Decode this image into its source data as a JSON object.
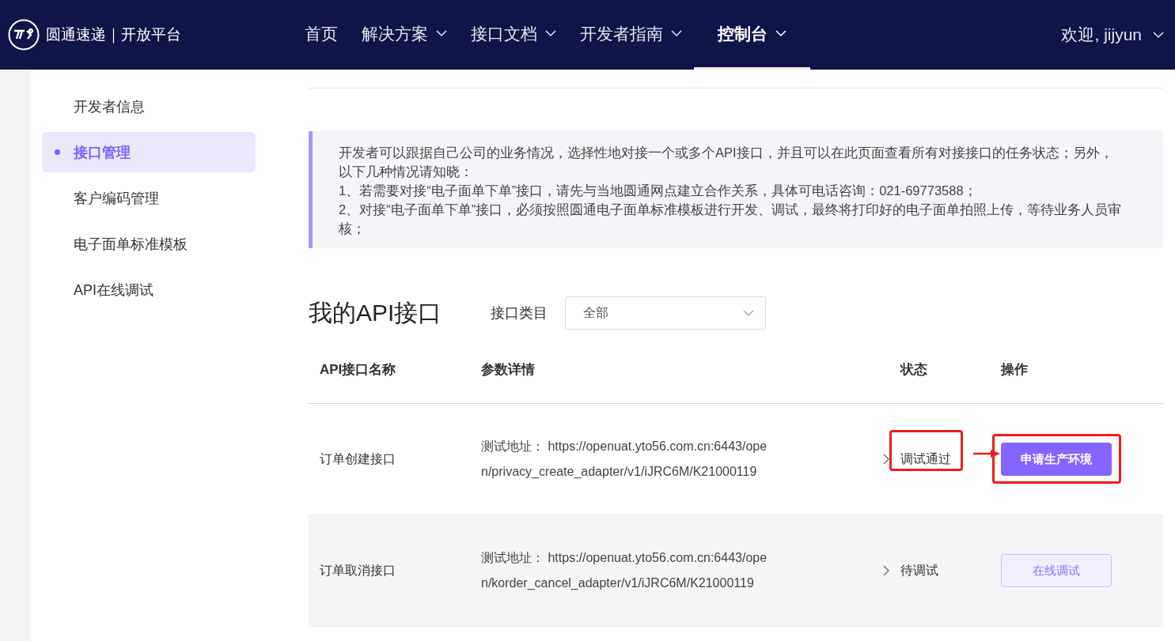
{
  "header": {
    "brand": "圆通速递｜开放平台",
    "nav": [
      {
        "label": "首页",
        "dropdown": false,
        "selected": false
      },
      {
        "label": "解决方案",
        "dropdown": true,
        "selected": false
      },
      {
        "label": "接口文档",
        "dropdown": true,
        "selected": false
      },
      {
        "label": "开发者指南",
        "dropdown": true,
        "selected": false
      },
      {
        "label": "控制台",
        "dropdown": true,
        "selected": true
      }
    ],
    "user": "欢迎, jijyun"
  },
  "sidebar": {
    "items": [
      {
        "label": "开发者信息",
        "selected": false
      },
      {
        "label": "接口管理",
        "selected": true
      },
      {
        "label": "客户编码管理",
        "selected": false
      },
      {
        "label": "电子面单标准模板",
        "selected": false
      },
      {
        "label": "API在线调试",
        "selected": false
      }
    ]
  },
  "notice": {
    "lines": [
      "开发者可以跟据自己公司的业务情况，选择性地对接一个或多个API接口，并且可以在此页面查看所有对接接口的任务状态；另外，以下几种情况请知晓：",
      "1、若需要对接“电子面单下单”接口，请先与当地圆通网点建立合作关系，具体可电话咨询：021-69773588；",
      "2、对接“电子面单下单”接口，必须按照圆通电子面单标准模板进行开发、调试，最终将打印好的电子面单拍照上传，等待业务人员审核；"
    ]
  },
  "section_title": "我的API接口",
  "filter": {
    "label": "接口类目",
    "value": "全部"
  },
  "table": {
    "columns": [
      "API接口名称",
      "参数详情",
      "状态",
      "操作"
    ],
    "rows": [
      {
        "name": "订单创建接口",
        "params": "测试地址： https://openuat.yto56.com.cn:6443/open/privacy_create_adapter/v1/iJRC6M/K21000119",
        "status": "调试通过",
        "action": {
          "kind": "primary",
          "label": "申请生产环境"
        },
        "annotated": true
      },
      {
        "name": "订单取消接口",
        "params": "测试地址： https://openuat.yto56.com.cn:6443/open/korder_cancel_adapter/v1/iJRC6M/K21000119",
        "status": "待调试",
        "action": {
          "kind": "secondary",
          "label": "在线调试"
        },
        "annotated": false
      }
    ]
  }
}
